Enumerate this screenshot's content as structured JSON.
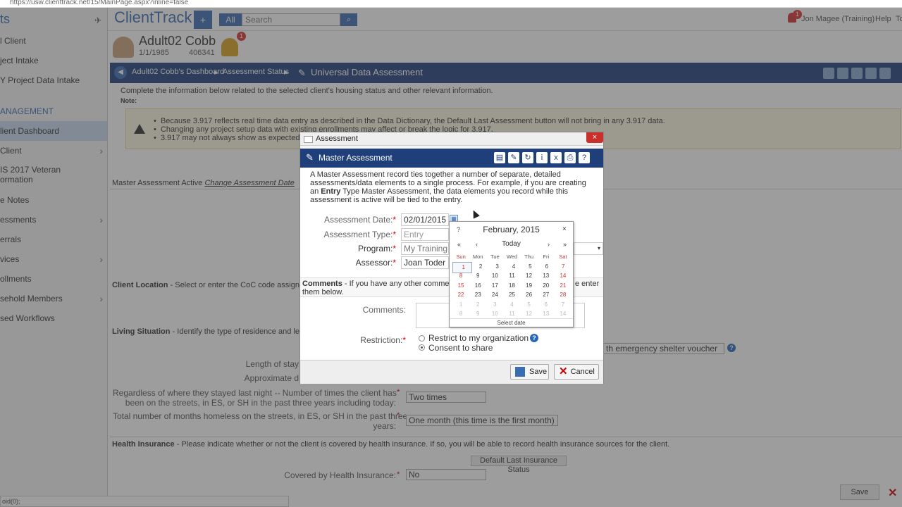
{
  "browser": {
    "url": "https://usw.clienttrack.net/15/MainPage.aspx?inline=false"
  },
  "sidebar": {
    "header": "ts",
    "items": [
      {
        "label": "l Client"
      },
      {
        "label": "ject Intake"
      },
      {
        "label": "Y Project Data Intake"
      }
    ],
    "section": "ANAGEMENT",
    "section_items": [
      {
        "label": "lient Dashboard"
      },
      {
        "label": "Client"
      },
      {
        "label_line1": "IS 2017 Veteran",
        "label_line2": "ormation"
      },
      {
        "label": "e Notes"
      },
      {
        "label": "essments"
      },
      {
        "label": "errals"
      },
      {
        "label": "vices"
      },
      {
        "label": "ollments"
      },
      {
        "label": "sehold Members"
      },
      {
        "label": "sed Workflows"
      }
    ]
  },
  "topbar": {
    "logo": "ClientTrack",
    "plus": "+",
    "all": "All",
    "search_placeholder": "Search",
    "user": "Jon Magee (Training)",
    "help": "Help",
    "tools": "Tools",
    "notification_count": "1"
  },
  "client": {
    "name": "Adult02 Cobb",
    "dob": "1/1/1985",
    "id": "406341",
    "alert_count": "1"
  },
  "breadcrumb": {
    "items": [
      "Adult02 Cobb's Dashboard",
      "Assessment Status"
    ],
    "title": "Universal Data Assessment"
  },
  "main": {
    "intro": "Complete the information below related to the selected client's housing status and other relevant information.",
    "note_label": "Note:",
    "warnings": [
      "Because 3.917 reflects real time data entry as described in the Data Dictionary, the Default Last Assessment button will not bring in any 3.917 data.",
      "Changing any project setup data with existing enrollments may affect or break the logic for 3.917.",
      "3.917 may not always show as expected  be"
    ],
    "master_assessment": "Master Assessment Active",
    "change_date": "Change Assessment Date",
    "client_location_title": "Client Location",
    "client_location_text": " - Select or enter the CoC code assigned to th",
    "living_situation_title": "Living Situation",
    "living_situation_text": " - Identify the type of residence and length of",
    "length_stay": "Length of stay",
    "approx": "Approximate d",
    "voucher_select": "th emergency shelter voucher",
    "times_q_line1": "Regardless of where they stayed last night -- Number of times the client has",
    "times_q_line2": "been on the streets, in ES, or SH in the past three years including today:",
    "times_value": "Two times",
    "months_q_line1": "Total number of months homeless on the streets, in ES, or SH in the past three",
    "months_q_line2": "years:",
    "months_value": "One month (this time is the first month)",
    "health_title": "Health Insurance",
    "health_text": " - Please indicate whether or not the client is covered by health insurance. If so, you will be able to record health insurance sources for the client.",
    "default_btn": "Default Last Insurance Status",
    "covered_label": "Covered by Health Insurance:",
    "covered_value": "No",
    "bottom_save": "Save",
    "status_text": "oid(0);"
  },
  "modal": {
    "window_title": "Assessment",
    "close": "×",
    "header": "Master Assessment",
    "desc_part1": "A Master Assessment record ties together a number of separate, detailed assessments/data elements to a single process. For example, if you are creating an ",
    "desc_bold": "Entry",
    "desc_part2": " Type Master Assessment, the data elements you record while this assessment is active will be tied to the entry.",
    "fields": {
      "date_label": "Assessment Date:",
      "date_value": "02/01/2015",
      "type_label": "Assessment Type:",
      "type_value": "Entry",
      "program_label": "Program:",
      "program_value": "My Training P",
      "assessor_label": "Assessor:",
      "assessor_value": "Joan Toder"
    },
    "comments_title": "Comments",
    "comments_text1": " - If you have any other comments o",
    "comments_text2": "e enter",
    "comments_text3": "them below.",
    "comments_label": "Comments:",
    "restriction_label": "Restriction:",
    "restrict_option": "Restrict to my organization",
    "consent_option": "Consent to share",
    "save": "Save",
    "cancel": "Cancel"
  },
  "calendar": {
    "help": "?",
    "title": "February, 2015",
    "close": "×",
    "prev_year": "«",
    "prev_month": "‹",
    "today": "Today",
    "next_month": "›",
    "next_year": "»",
    "weekdays": [
      "Sun",
      "Mon",
      "Tue",
      "Wed",
      "Thu",
      "Fri",
      "Sat"
    ],
    "weeks": [
      [
        "1",
        "2",
        "3",
        "4",
        "5",
        "6",
        "7"
      ],
      [
        "8",
        "9",
        "10",
        "11",
        "12",
        "13",
        "14"
      ],
      [
        "15",
        "16",
        "17",
        "18",
        "19",
        "20",
        "21"
      ],
      [
        "22",
        "23",
        "24",
        "25",
        "26",
        "27",
        "28"
      ],
      [
        "1",
        "2",
        "3",
        "4",
        "5",
        "6",
        "7"
      ],
      [
        "8",
        "9",
        "10",
        "11",
        "12",
        "13",
        "14"
      ]
    ],
    "footer": "Select date"
  }
}
